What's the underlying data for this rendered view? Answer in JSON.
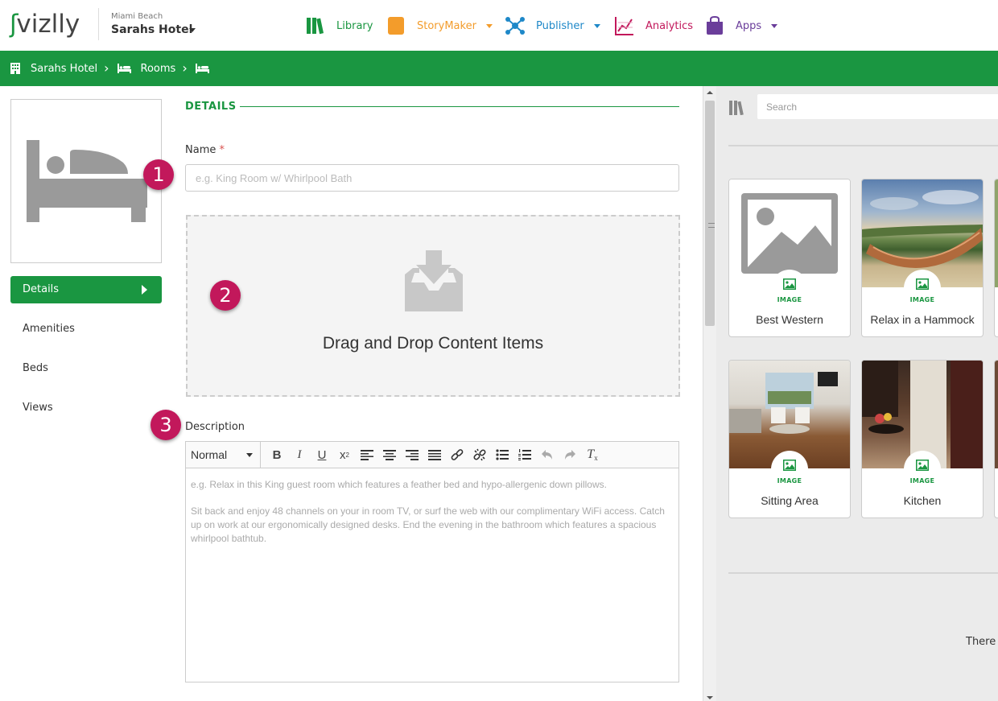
{
  "brand": {
    "logo": "vizlly",
    "logo_first": "ⓥ"
  },
  "hotel": {
    "location": "Miami Beach",
    "name": "Sarahs Hotel"
  },
  "nav": [
    {
      "label": "Library",
      "color": "#1a9641",
      "icon": "library-icon"
    },
    {
      "label": "StoryMaker",
      "color": "#f39c2b",
      "icon": "storymaker-icon"
    },
    {
      "label": "Publisher",
      "color": "#1e88c8",
      "icon": "publisher-icon"
    },
    {
      "label": "Analytics",
      "color": "#c2185b",
      "icon": "analytics-icon"
    },
    {
      "label": "Apps",
      "color": "#6a3d9a",
      "icon": "apps-icon"
    }
  ],
  "breadcrumb": {
    "hotel": "Sarahs Hotel",
    "rooms": "Rooms"
  },
  "sidenav": {
    "items": [
      "Details",
      "Amenities",
      "Beds",
      "Views"
    ]
  },
  "badges": [
    "1",
    "2",
    "3"
  ],
  "details": {
    "section_title": "DETAILS",
    "name_label": "Name",
    "required_mark": "*",
    "name_placeholder": "e.g. King Room w/ Whirlpool Bath",
    "dropzone_text": "Drag and Drop Content Items",
    "description_label": "Description",
    "format_value": "Normal",
    "description_placeholder_1": "e.g. Relax in this King guest room which features a feather bed and hypo-allergenic down pillows.",
    "description_placeholder_2": "Sit back and enjoy 48 channels on your in room TV, or surf the web with our complimentary WiFi access. Catch up on work at our ergonomically designed desks. End the evening in the bathroom which features a spacious whirlpool bathtub."
  },
  "library_panel": {
    "search_placeholder": "Search",
    "cards": [
      {
        "type": "IMAGE",
        "title": "Best Western"
      },
      {
        "type": "IMAGE",
        "title": "Relax in a Hammock"
      },
      {
        "type": "IMAGE",
        "title": "Sitting Area"
      },
      {
        "type": "IMAGE",
        "title": "Kitchen"
      }
    ],
    "footer_text": "There a"
  },
  "colors": {
    "brand_green": "#1a9641",
    "badge": "#c2185b"
  }
}
